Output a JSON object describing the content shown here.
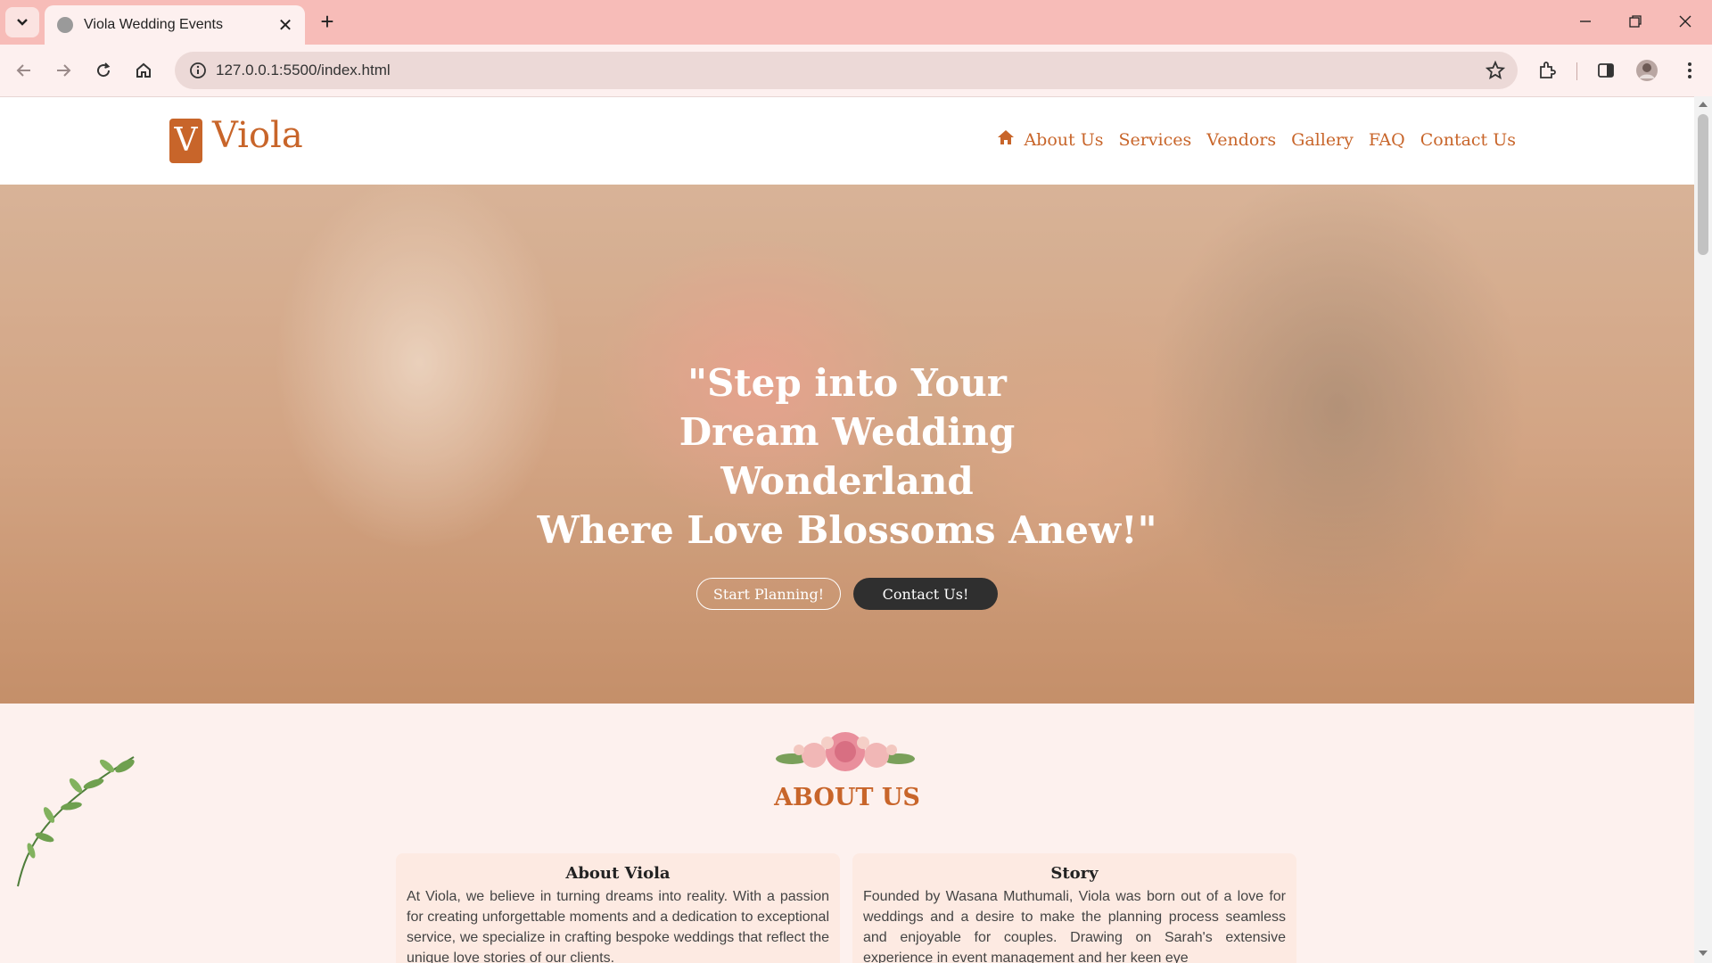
{
  "browser": {
    "tab_title": "Viola Wedding Events",
    "url": "127.0.0.1:5500/index.html"
  },
  "site": {
    "logo_letter": "V",
    "logo_text": "Viola",
    "nav": [
      "About Us",
      "Services",
      "Vendors",
      "Gallery",
      "FAQ",
      "Contact Us"
    ]
  },
  "hero": {
    "title_lines": [
      "\"Step into Your",
      "Dream Wedding",
      "Wonderland",
      "Where Love Blossoms Anew!\""
    ],
    "btn_primary": "Start Planning!",
    "btn_secondary": "Contact Us!"
  },
  "about": {
    "heading": "ABOUT US",
    "cards": [
      {
        "title": "About Viola",
        "text": "At Viola, we believe in turning dreams into reality. With a passion for creating unforgettable moments and a dedication to exceptional service, we specialize in crafting bespoke weddings that reflect the unique love stories of our clients."
      },
      {
        "title": "Story",
        "text": "Founded by Wasana Muthumali, Viola was born out of a love for weddings and a desire to make the planning process seamless and enjoyable for couples. Drawing on Sarah's extensive experience in event management and her keen eye"
      }
    ]
  },
  "colors": {
    "brand": "#c8652a",
    "chrome": "#f7bcb8",
    "dark_button": "#2f2f2f"
  },
  "icons": [
    "chevron-down-icon",
    "globe-icon",
    "close-icon",
    "plus-icon",
    "minimize-icon",
    "restore-icon",
    "back-icon",
    "forward-icon",
    "reload-icon",
    "home-icon",
    "info-icon",
    "star-icon",
    "extensions-icon",
    "sidepanel-icon",
    "profile-icon",
    "menu-icon"
  ]
}
